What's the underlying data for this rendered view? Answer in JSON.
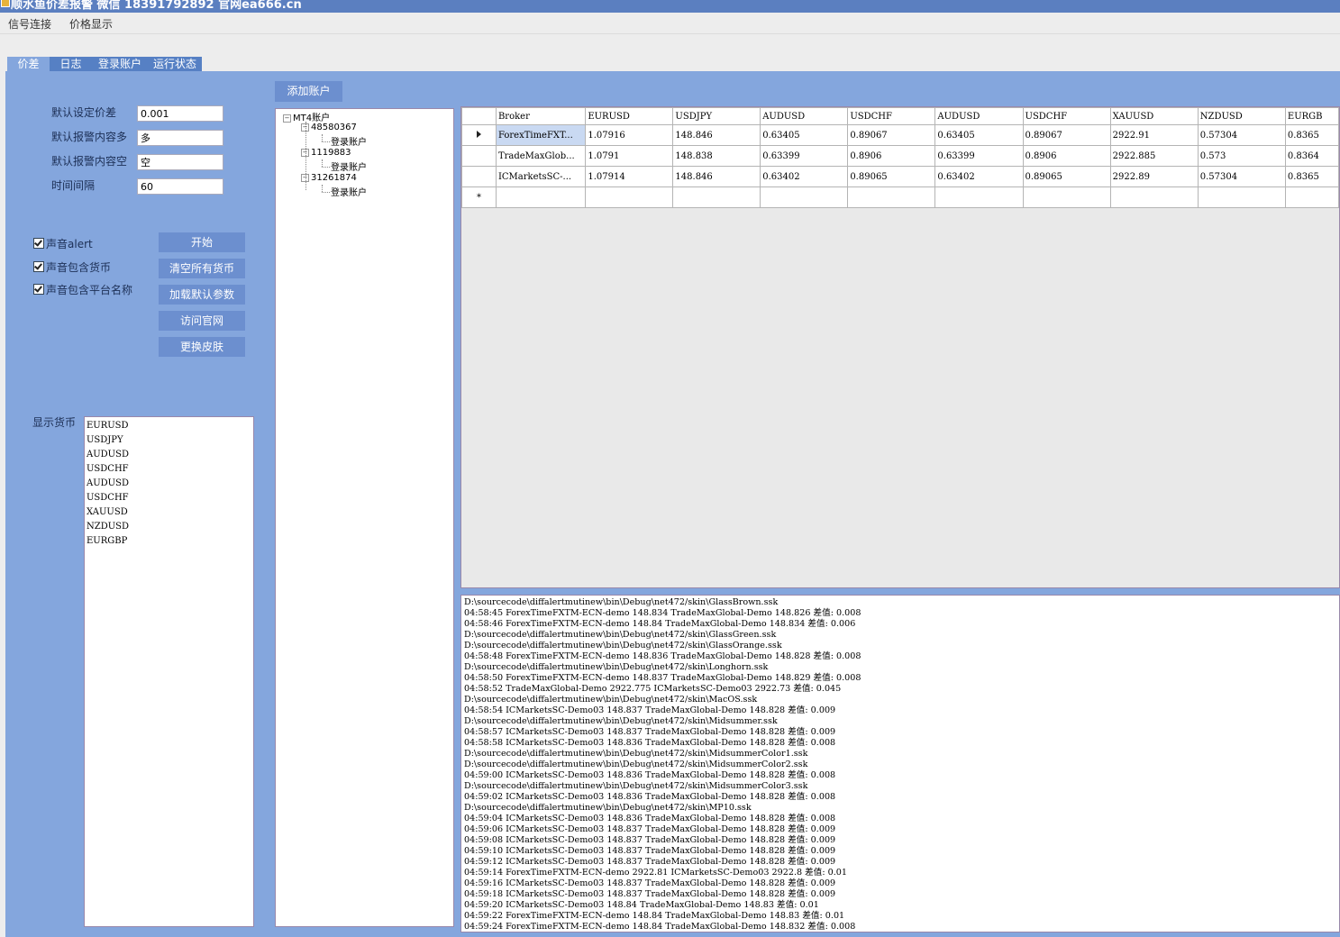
{
  "window": {
    "title": "顺水鱼价差报警  微信  18391792892  官网ea666.cn"
  },
  "menu": {
    "items": [
      "信号连接",
      "价格显示"
    ]
  },
  "tabs": [
    "价差",
    "日志",
    "登录账户",
    "运行状态"
  ],
  "settings": {
    "spread_label": "默认设定价差",
    "spread_value": "0.001",
    "long_label": "默认报警内容多",
    "long_value": "多",
    "short_label": "默认报警内容空",
    "short_value": "空",
    "interval_label": "时间间隔",
    "interval_value": "60"
  },
  "checkboxes": [
    "声音alert",
    "声音包含货币",
    "声音包含平台名称"
  ],
  "buttons": [
    "开始",
    "清空所有货币",
    "加载默认参数",
    "访问官网",
    "更换皮肤"
  ],
  "currency_label": "显示货币",
  "currencies": [
    "EURUSD",
    "USDJPY",
    "AUDUSD",
    "USDCHF",
    "AUDUSD",
    "USDCHF",
    "XAUUSD",
    "NZDUSD",
    "EURGBP"
  ],
  "add_account_label": "添加账户",
  "tree": {
    "root": "MT4账户",
    "accounts": [
      {
        "id": "48580367",
        "child": "登录账户"
      },
      {
        "id": "1119883",
        "child": "登录账户"
      },
      {
        "id": "31261874",
        "child": "登录账户"
      }
    ]
  },
  "grid": {
    "columns": [
      "Broker",
      "EURUSD",
      "USDJPY",
      "AUDUSD",
      "USDCHF",
      "AUDUSD",
      "USDCHF",
      "XAUUSD",
      "NZDUSD",
      "EURGB"
    ],
    "rows": [
      [
        "ForexTimeFXT...",
        "1.07916",
        "148.846",
        "0.63405",
        "0.89067",
        "0.63405",
        "0.89067",
        "2922.91",
        "0.57304",
        "0.8365"
      ],
      [
        "TradeMaxGlob...",
        "1.0791",
        "148.838",
        "0.63399",
        "0.8906",
        "0.63399",
        "0.8906",
        "2922.885",
        "0.573",
        "0.8364"
      ],
      [
        "ICMarketsSC-...",
        "1.07914",
        "148.846",
        "0.63402",
        "0.89065",
        "0.63402",
        "0.89065",
        "2922.89",
        "0.57304",
        "0.8365"
      ]
    ],
    "new_row_marker": "*"
  },
  "log": [
    "D:\\sourcecode\\diffalertmutinew\\bin\\Debug\\net472/skin\\GlassBrown.ssk",
    "04:58:45 ForexTimeFXTM-ECN-demo 148.834 TradeMaxGlobal-Demo 148.826 差值: 0.008",
    "04:58:46 ForexTimeFXTM-ECN-demo 148.84 TradeMaxGlobal-Demo 148.834 差值: 0.006",
    "D:\\sourcecode\\diffalertmutinew\\bin\\Debug\\net472/skin\\GlassGreen.ssk",
    "D:\\sourcecode\\diffalertmutinew\\bin\\Debug\\net472/skin\\GlassOrange.ssk",
    "04:58:48 ForexTimeFXTM-ECN-demo 148.836 TradeMaxGlobal-Demo 148.828 差值: 0.008",
    "D:\\sourcecode\\diffalertmutinew\\bin\\Debug\\net472/skin\\Longhorn.ssk",
    "04:58:50 ForexTimeFXTM-ECN-demo 148.837 TradeMaxGlobal-Demo 148.829 差值: 0.008",
    "04:58:52 TradeMaxGlobal-Demo 2922.775 ICMarketsSC-Demo03 2922.73 差值: 0.045",
    "D:\\sourcecode\\diffalertmutinew\\bin\\Debug\\net472/skin\\MacOS.ssk",
    "04:58:54 ICMarketsSC-Demo03 148.837 TradeMaxGlobal-Demo 148.828 差值: 0.009",
    "D:\\sourcecode\\diffalertmutinew\\bin\\Debug\\net472/skin\\Midsummer.ssk",
    "04:58:57 ICMarketsSC-Demo03 148.837 TradeMaxGlobal-Demo 148.828 差值: 0.009",
    "04:58:58 ICMarketsSC-Demo03 148.836 TradeMaxGlobal-Demo 148.828 差值: 0.008",
    "D:\\sourcecode\\diffalertmutinew\\bin\\Debug\\net472/skin\\MidsummerColor1.ssk",
    "D:\\sourcecode\\diffalertmutinew\\bin\\Debug\\net472/skin\\MidsummerColor2.ssk",
    "04:59:00 ICMarketsSC-Demo03 148.836 TradeMaxGlobal-Demo 148.828 差值: 0.008",
    "D:\\sourcecode\\diffalertmutinew\\bin\\Debug\\net472/skin\\MidsummerColor3.ssk",
    "04:59:02 ICMarketsSC-Demo03 148.836 TradeMaxGlobal-Demo 148.828 差值: 0.008",
    "D:\\sourcecode\\diffalertmutinew\\bin\\Debug\\net472/skin\\MP10.ssk",
    "04:59:04 ICMarketsSC-Demo03 148.836 TradeMaxGlobal-Demo 148.828 差值: 0.008",
    "04:59:06 ICMarketsSC-Demo03 148.837 TradeMaxGlobal-Demo 148.828 差值: 0.009",
    "04:59:08 ICMarketsSC-Demo03 148.837 TradeMaxGlobal-Demo 148.828 差值: 0.009",
    "04:59:10 ICMarketsSC-Demo03 148.837 TradeMaxGlobal-Demo 148.828 差值: 0.009",
    "04:59:12 ICMarketsSC-Demo03 148.837 TradeMaxGlobal-Demo 148.828 差值: 0.009",
    "04:59:14 ForexTimeFXTM-ECN-demo 2922.81 ICMarketsSC-Demo03 2922.8 差值: 0.01",
    "04:59:16 ICMarketsSC-Demo03 148.837 TradeMaxGlobal-Demo 148.828 差值: 0.009",
    "04:59:18 ICMarketsSC-Demo03 148.837 TradeMaxGlobal-Demo 148.828 差值: 0.009",
    "04:59:20 ICMarketsSC-Demo03 148.84 TradeMaxGlobal-Demo 148.83 差值: 0.01",
    "04:59:22 ForexTimeFXTM-ECN-demo 148.84 TradeMaxGlobal-Demo 148.83 差值: 0.01",
    "04:59:24 ForexTimeFXTM-ECN-demo 148.84 TradeMaxGlobal-Demo 148.832 差值: 0.008"
  ],
  "colors": {
    "panel": "#84a6dd",
    "button": "#6c8fcf",
    "titlebar": "#5b7fc0"
  }
}
